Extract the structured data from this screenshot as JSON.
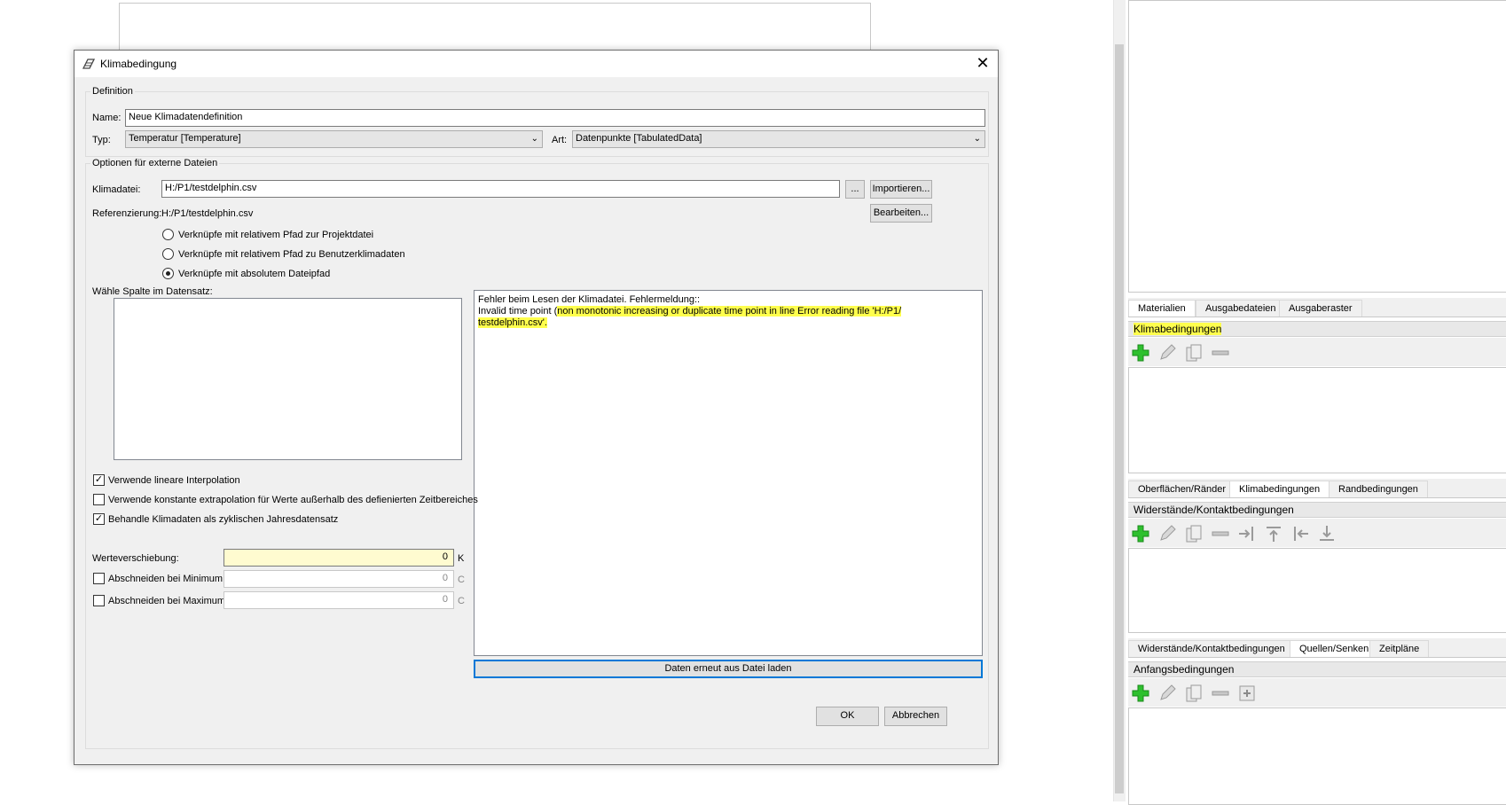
{
  "dialog": {
    "title": "Klimabedingung",
    "definition_group": "Definition",
    "name_label": "Name:",
    "name_value": "Neue Klimadatendefinition",
    "type_label": "Typ:",
    "type_value": "Temperatur [Temperature]",
    "art_label": "Art:",
    "art_value": "Datenpunkte [TabulatedData]",
    "external_group": "Optionen für externe Dateien",
    "klimadatei_label": "Klimadatei:",
    "klimadatei_value": "H:/P1/testdelphin.csv",
    "browse_label": "...",
    "import_label": "Importieren...",
    "referenz_label": "Referenzierung:",
    "referenz_value": "H:/P1/testdelphin.csv",
    "edit_label": "Bearbeiten...",
    "radio_relative_project": "Verknüpfe mit relativem Pfad zur Projektdatei",
    "radio_relative_user": "Verknüpfe mit relativem Pfad zu Benutzerklimadaten",
    "radio_absolute": "Verknüpfe mit absolutem Dateipfad",
    "column_label": "Wähle Spalte im Datensatz:",
    "message_line1": "Fehler beim Lesen der Klimadatei. Fehlermeldung::",
    "message_line2_plain": "Invalid time point (",
    "message_line2_hl": "non monotonic increasing or duplicate time point in line Error reading file 'H:/P1/",
    "message_line3_hl": "testdelphin.csv'.",
    "chk_linear": "Verwende lineare Interpolation",
    "chk_constant": "Verwende konstante extrapolation für Werte außerhalb des defienierten Zeitbereiches",
    "chk_cyclic": "Behandle Klimadaten als zyklischen Jahresdatensatz",
    "shift_label": "Werteverschiebung:",
    "shift_value": "0",
    "shift_unit": "K",
    "min_label": "Abschneiden bei Minimum:",
    "min_value": "0",
    "min_unit": "C",
    "max_label": "Abschneiden bei Maximum:",
    "max_value": "0",
    "max_unit": "C",
    "reload_label": "Daten erneut aus Datei laden",
    "ok_label": "OK",
    "cancel_label": "Abbrechen"
  },
  "right_panel": {
    "tabs1": [
      "Materialien",
      "Ausgabedateien",
      "Ausgaberaster"
    ],
    "header1": "Klimabedingungen",
    "tabs2": [
      "Oberflächen/Ränder",
      "Klimabedingungen",
      "Randbedingungen"
    ],
    "header2": "Widerstände/Kontaktbedingungen",
    "tabs3": [
      "Widerstände/Kontaktbedingungen",
      "Quellen/Senken",
      "Zeitpläne"
    ],
    "header3": "Anfangsbedingungen"
  },
  "colors": {
    "highlight": "#ffff4d",
    "add_green": "#2ec02e",
    "accent_blue": "#0078d7"
  }
}
